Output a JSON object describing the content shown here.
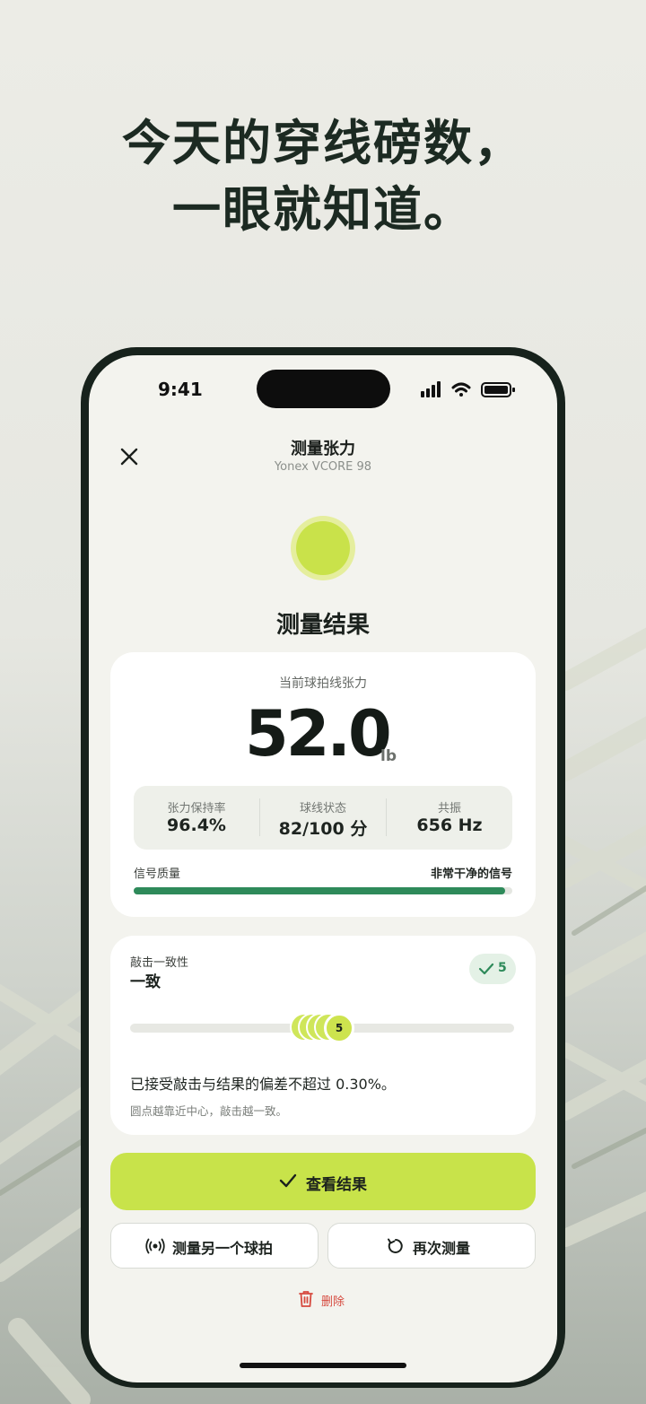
{
  "headline": {
    "line1": "今天的穿线磅数，",
    "line2": "一眼就知道。"
  },
  "status_bar": {
    "time": "9:41"
  },
  "nav": {
    "title": "测量张力",
    "subtitle": "Yonex VCORE 98"
  },
  "result": {
    "title": "测量结果",
    "tension_label": "当前球拍线张力",
    "tension_value": "52.0",
    "tension_unit": "lb",
    "stats": [
      {
        "label": "张力保持率",
        "value": "96.4%"
      },
      {
        "label": "球线状态",
        "value": "82/100 分"
      },
      {
        "label": "共振",
        "value": "656 Hz"
      }
    ],
    "signal": {
      "label": "信号质量",
      "value": "非常干净的信号",
      "level": 0.98
    }
  },
  "consistency": {
    "label": "敲击一致性",
    "value": "一致",
    "badge_count": "5",
    "hit_count": "5",
    "text": "已接受敲击与结果的偏差不超过 0.30%。",
    "note": "圆点越靠近中心，敲击越一致。"
  },
  "actions": {
    "view_result": "查看结果",
    "measure_another": "测量另一个球拍",
    "measure_again": "再次测量",
    "delete": "删除"
  },
  "colors": {
    "accent": "#c8e34a",
    "success": "#2e8a5a",
    "danger": "#d64a3f"
  }
}
